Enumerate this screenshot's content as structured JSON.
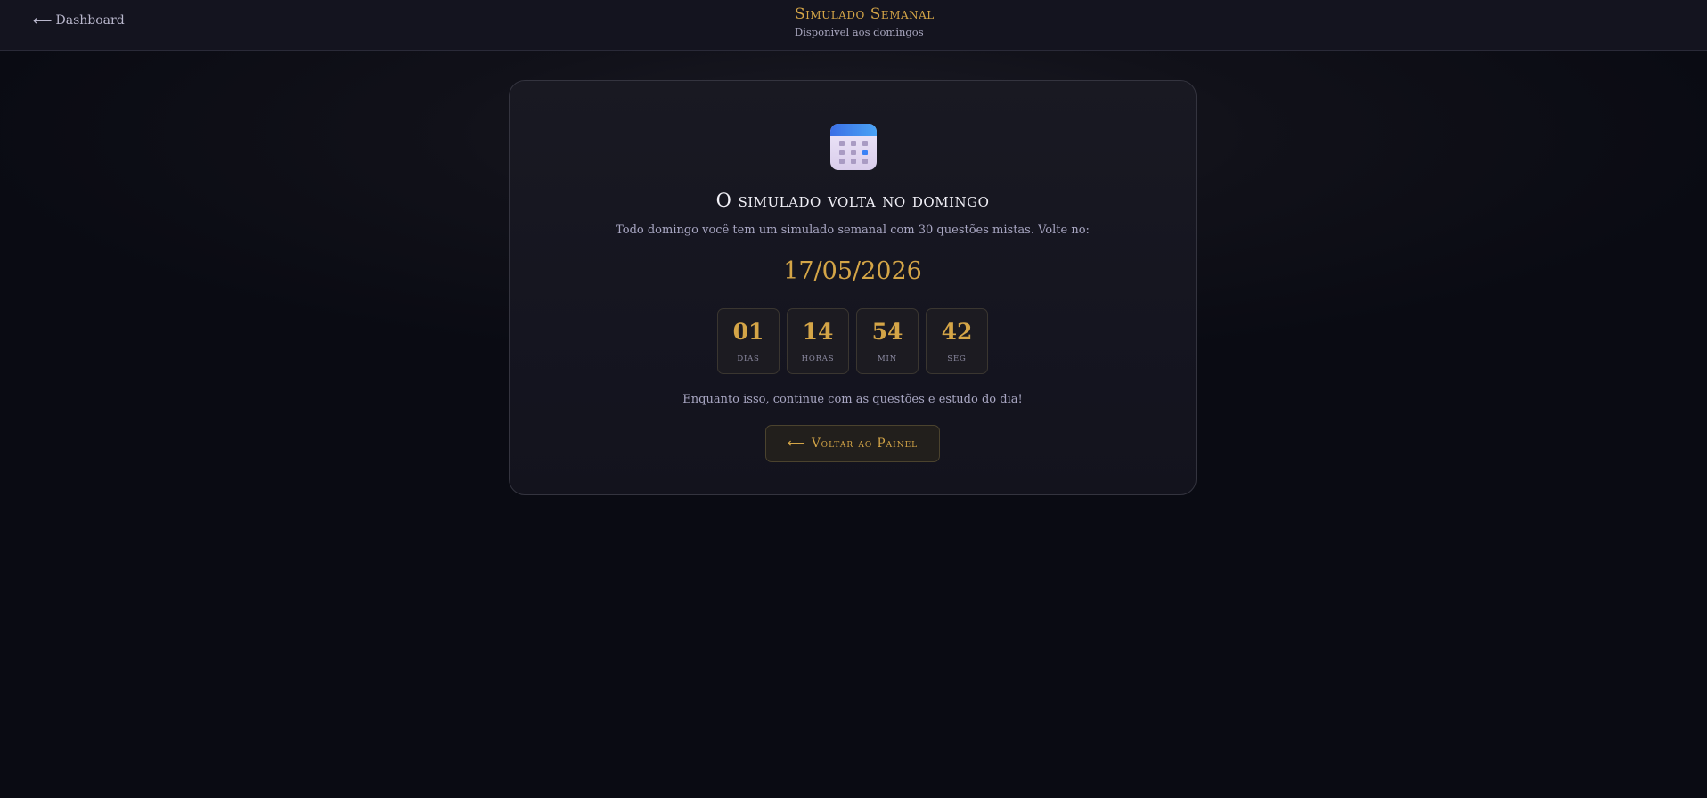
{
  "header": {
    "back_arrow": "⟵",
    "back_label": "Dashboard",
    "title": "Simulado Semanal",
    "subtitle": "Disponível aos domingos"
  },
  "card": {
    "icon": "calendar-icon",
    "title": "O simulado volta no domingo",
    "description": "Todo domingo você tem um simulado semanal com 30 questões mistas. Volte no:",
    "date": "17/05/2026",
    "countdown": [
      {
        "value": "01",
        "label": "DIAS"
      },
      {
        "value": "14",
        "label": "HORAS"
      },
      {
        "value": "54",
        "label": "MIN"
      },
      {
        "value": "42",
        "label": "SEG"
      }
    ],
    "note": "Enquanto isso, continue com as questões e estudo do dia!",
    "button_arrow": "⟵",
    "button_label": "Voltar ao Painel"
  },
  "colors": {
    "accent_gold": "#d4a547",
    "background": "#0a0b13",
    "card_background": "#171720",
    "calendar_header": "#3b82f6",
    "calendar_body": "#e4d9f3"
  }
}
